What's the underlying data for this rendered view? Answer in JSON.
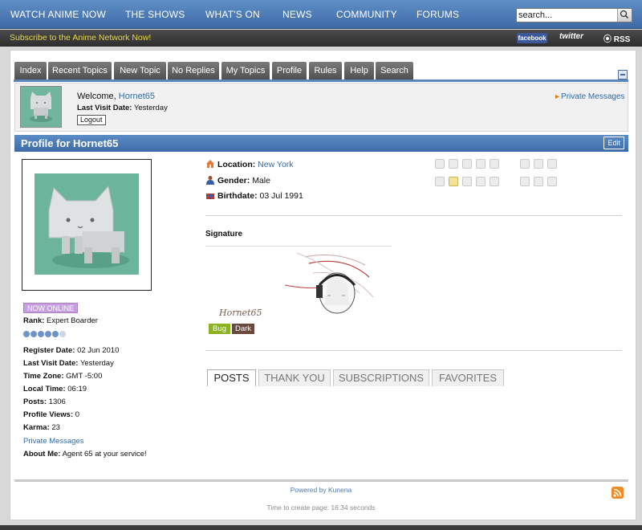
{
  "topnav": {
    "items": [
      "WATCH ANIME NOW",
      "THE SHOWS",
      "WHAT'S ON",
      "NEWS",
      "COMMUNITY",
      "FORUMS"
    ],
    "search_value": "search..."
  },
  "subbar": {
    "subscribe": "Subscribe to the Anime Network Now!",
    "facebook": "facebook",
    "twitter": "twitter",
    "rss": "RSS"
  },
  "tabs": [
    "Index",
    "Recent Topics",
    "New Topic",
    "No Replies",
    "My Topics",
    "Profile",
    "Rules",
    "Help",
    "Search"
  ],
  "welcome": {
    "greeting": "Welcome, ",
    "username": "Hornet65",
    "last_visit_label": "Last Visit Date:",
    "last_visit_value": "Yesterday",
    "logout": "Logout",
    "private_messages": "Private Messages"
  },
  "profile": {
    "title": "Profile for Hornet65",
    "edit": "Edit",
    "online": "NOW ONLINE",
    "rank_label": "Rank:",
    "rank_value": "Expert Boarder",
    "rank_level": 5,
    "rank_max": 6,
    "register_label": "Register Date:",
    "register_value": "02 Jun 2010",
    "lastvisit_label": "Last Visit Date:",
    "lastvisit_value": "Yesterday",
    "timezone_label": "Time Zone:",
    "timezone_value": "GMT -5:00",
    "localtime_label": "Local Time:",
    "localtime_value": "06:19",
    "posts_label": "Posts:",
    "posts_value": "1306",
    "views_label": "Profile Views:",
    "views_value": "0",
    "karma_label": "Karma:",
    "karma_value": "23",
    "pm": "Private Messages",
    "about_label": "About Me:",
    "about_value": "Agent 65 at your service!"
  },
  "details": {
    "location_label": "Location:",
    "location_value": "New York",
    "gender_label": "Gender:",
    "gender_value": "Male",
    "birthdate_label": "Birthdate:",
    "birthdate_value": "03 Jul 1991",
    "signature_label": "Signature",
    "signature_name": "Hornet65",
    "badge_bug": "Bug",
    "badge_dark": "Dark"
  },
  "profile_tabs": [
    "POSTS",
    "THANK YOU",
    "SUBSCRIPTIONS",
    "FAVORITES"
  ],
  "footer": {
    "powered": "Powered by Kunena",
    "time": "Time to create page: 16.34 seconds"
  },
  "colors": {
    "nav_blue": "#4a7ab8",
    "header_blue": "#4e7fbb",
    "avatar_green": "#6cb59c",
    "online_purple": "#c79fe0",
    "link_blue": "#2f6aa5"
  }
}
